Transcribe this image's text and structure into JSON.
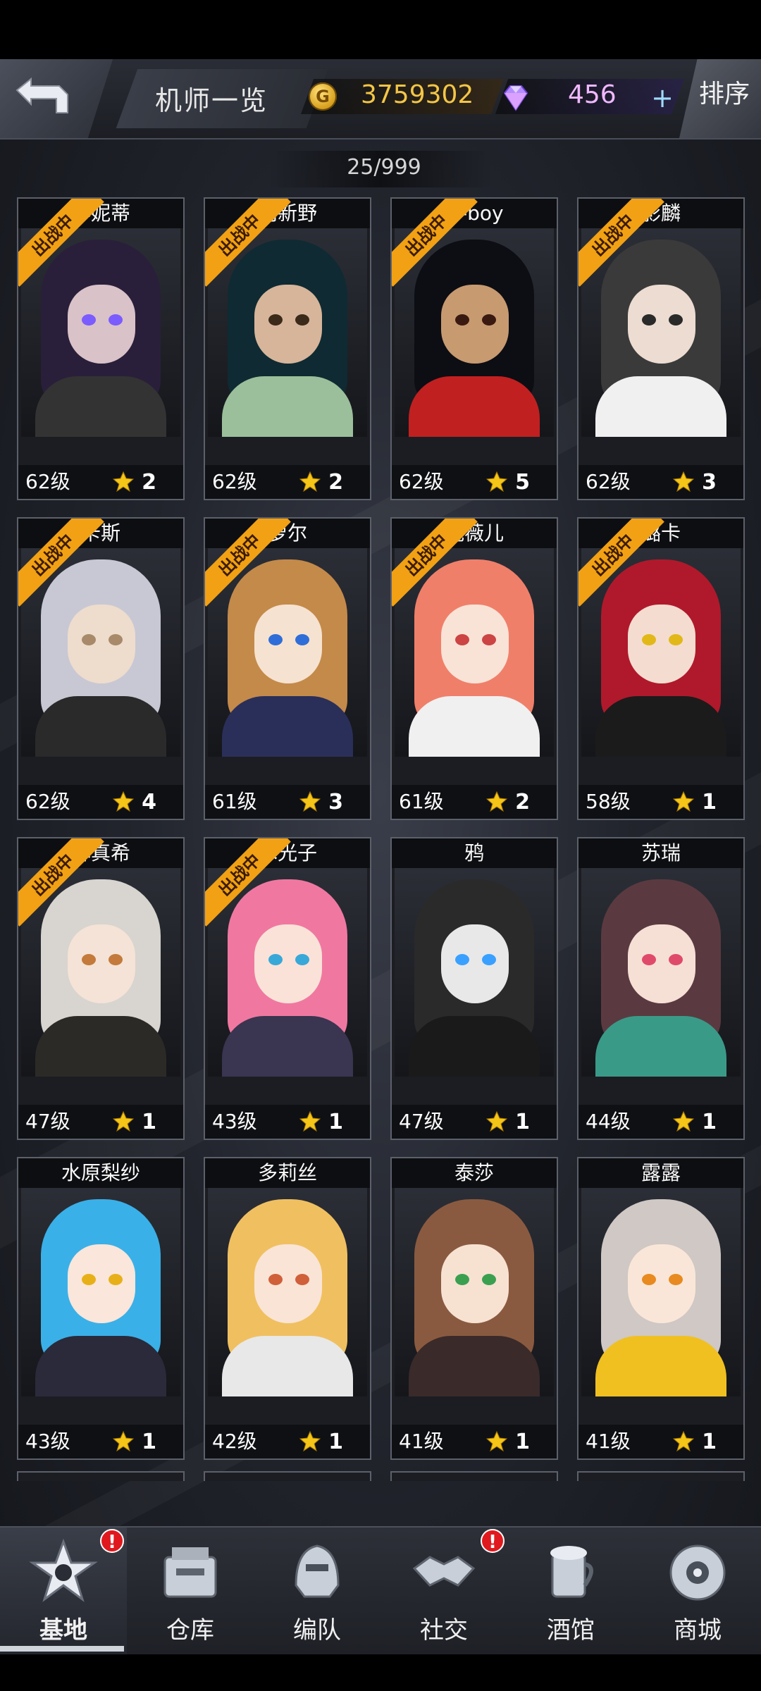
{
  "header": {
    "title": "机师一览",
    "gold": "3759302",
    "gems": "456",
    "add_symbol": "+",
    "sort_label": "排序"
  },
  "roster_count": "25/999",
  "deployed_label": "出战中",
  "pilots": [
    {
      "name": "李妮蒂",
      "level": "62级",
      "stars": "2",
      "deployed": true
    },
    {
      "name": "羽新野",
      "level": "62级",
      "stars": "2",
      "deployed": true
    },
    {
      "name": "D-boy",
      "level": "62级",
      "stars": "5",
      "deployed": true
    },
    {
      "name": "影麟",
      "level": "62级",
      "stars": "3",
      "deployed": true
    },
    {
      "name": "卡斯",
      "level": "62级",
      "stars": "4",
      "deployed": true
    },
    {
      "name": "萝尔",
      "level": "61级",
      "stars": "3",
      "deployed": true
    },
    {
      "name": "妮薇儿",
      "level": "61级",
      "stars": "2",
      "deployed": true
    },
    {
      "name": "璐卡",
      "level": "58级",
      "stars": "1",
      "deployed": true
    },
    {
      "name": "林真希",
      "level": "47级",
      "stars": "1",
      "deployed": true
    },
    {
      "name": "木光子",
      "level": "43级",
      "stars": "1",
      "deployed": true
    },
    {
      "name": "鸦",
      "level": "47级",
      "stars": "1",
      "deployed": false
    },
    {
      "name": "苏瑞",
      "level": "44级",
      "stars": "1",
      "deployed": false
    },
    {
      "name": "水原梨纱",
      "level": "43级",
      "stars": "1",
      "deployed": false
    },
    {
      "name": "多莉丝",
      "level": "42级",
      "stars": "1",
      "deployed": false
    },
    {
      "name": "泰莎",
      "level": "41级",
      "stars": "1",
      "deployed": false
    },
    {
      "name": "露露",
      "level": "41级",
      "stars": "1",
      "deployed": false
    }
  ],
  "nav": [
    {
      "label": "基地",
      "icon": "base-icon",
      "active": true,
      "alert": "!"
    },
    {
      "label": "仓库",
      "icon": "warehouse-icon",
      "active": false
    },
    {
      "label": "编队",
      "icon": "formation-icon",
      "active": false
    },
    {
      "label": "社交",
      "icon": "handshake-icon",
      "active": false,
      "alert": "!"
    },
    {
      "label": "酒馆",
      "icon": "tavern-icon",
      "active": false
    },
    {
      "label": "商城",
      "icon": "shop-icon",
      "active": false
    }
  ],
  "colors": {
    "gold": "#f4c646",
    "gem": "#f0b8ff",
    "ribbon": "#f2a114",
    "alert": "#e0191e"
  }
}
